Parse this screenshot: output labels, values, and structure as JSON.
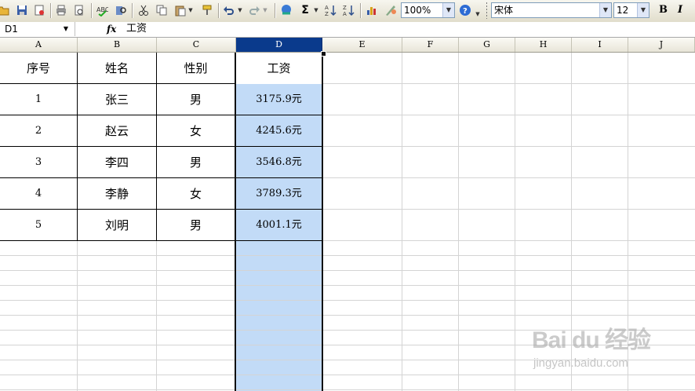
{
  "toolbar": {
    "zoom": "100%",
    "font_name": "宋体",
    "font_size": "12",
    "bold_label": "B",
    "italic_label": "I",
    "sum_label": "Σ"
  },
  "formula_bar": {
    "cell_ref": "D1",
    "fx_label": "fx",
    "content": "工资"
  },
  "columns": [
    "A",
    "B",
    "C",
    "D",
    "E",
    "F",
    "G",
    "H",
    "I",
    "J"
  ],
  "selected_column": "D",
  "table": {
    "headers": [
      "序号",
      "姓名",
      "性别",
      "工资"
    ],
    "rows": [
      [
        "1",
        "张三",
        "男",
        "3175.9元"
      ],
      [
        "2",
        "赵云",
        "女",
        "4245.6元"
      ],
      [
        "3",
        "李四",
        "男",
        "3546.8元"
      ],
      [
        "4",
        "李静",
        "女",
        "3789.3元"
      ],
      [
        "5",
        "刘明",
        "男",
        "4001.1元"
      ]
    ]
  },
  "watermark": {
    "logo": "Bai du 经验",
    "url": "jingyan.baidu.com"
  },
  "colors": {
    "selection_fill": "#c2dbf7",
    "selected_header": "#0a3a8c"
  }
}
